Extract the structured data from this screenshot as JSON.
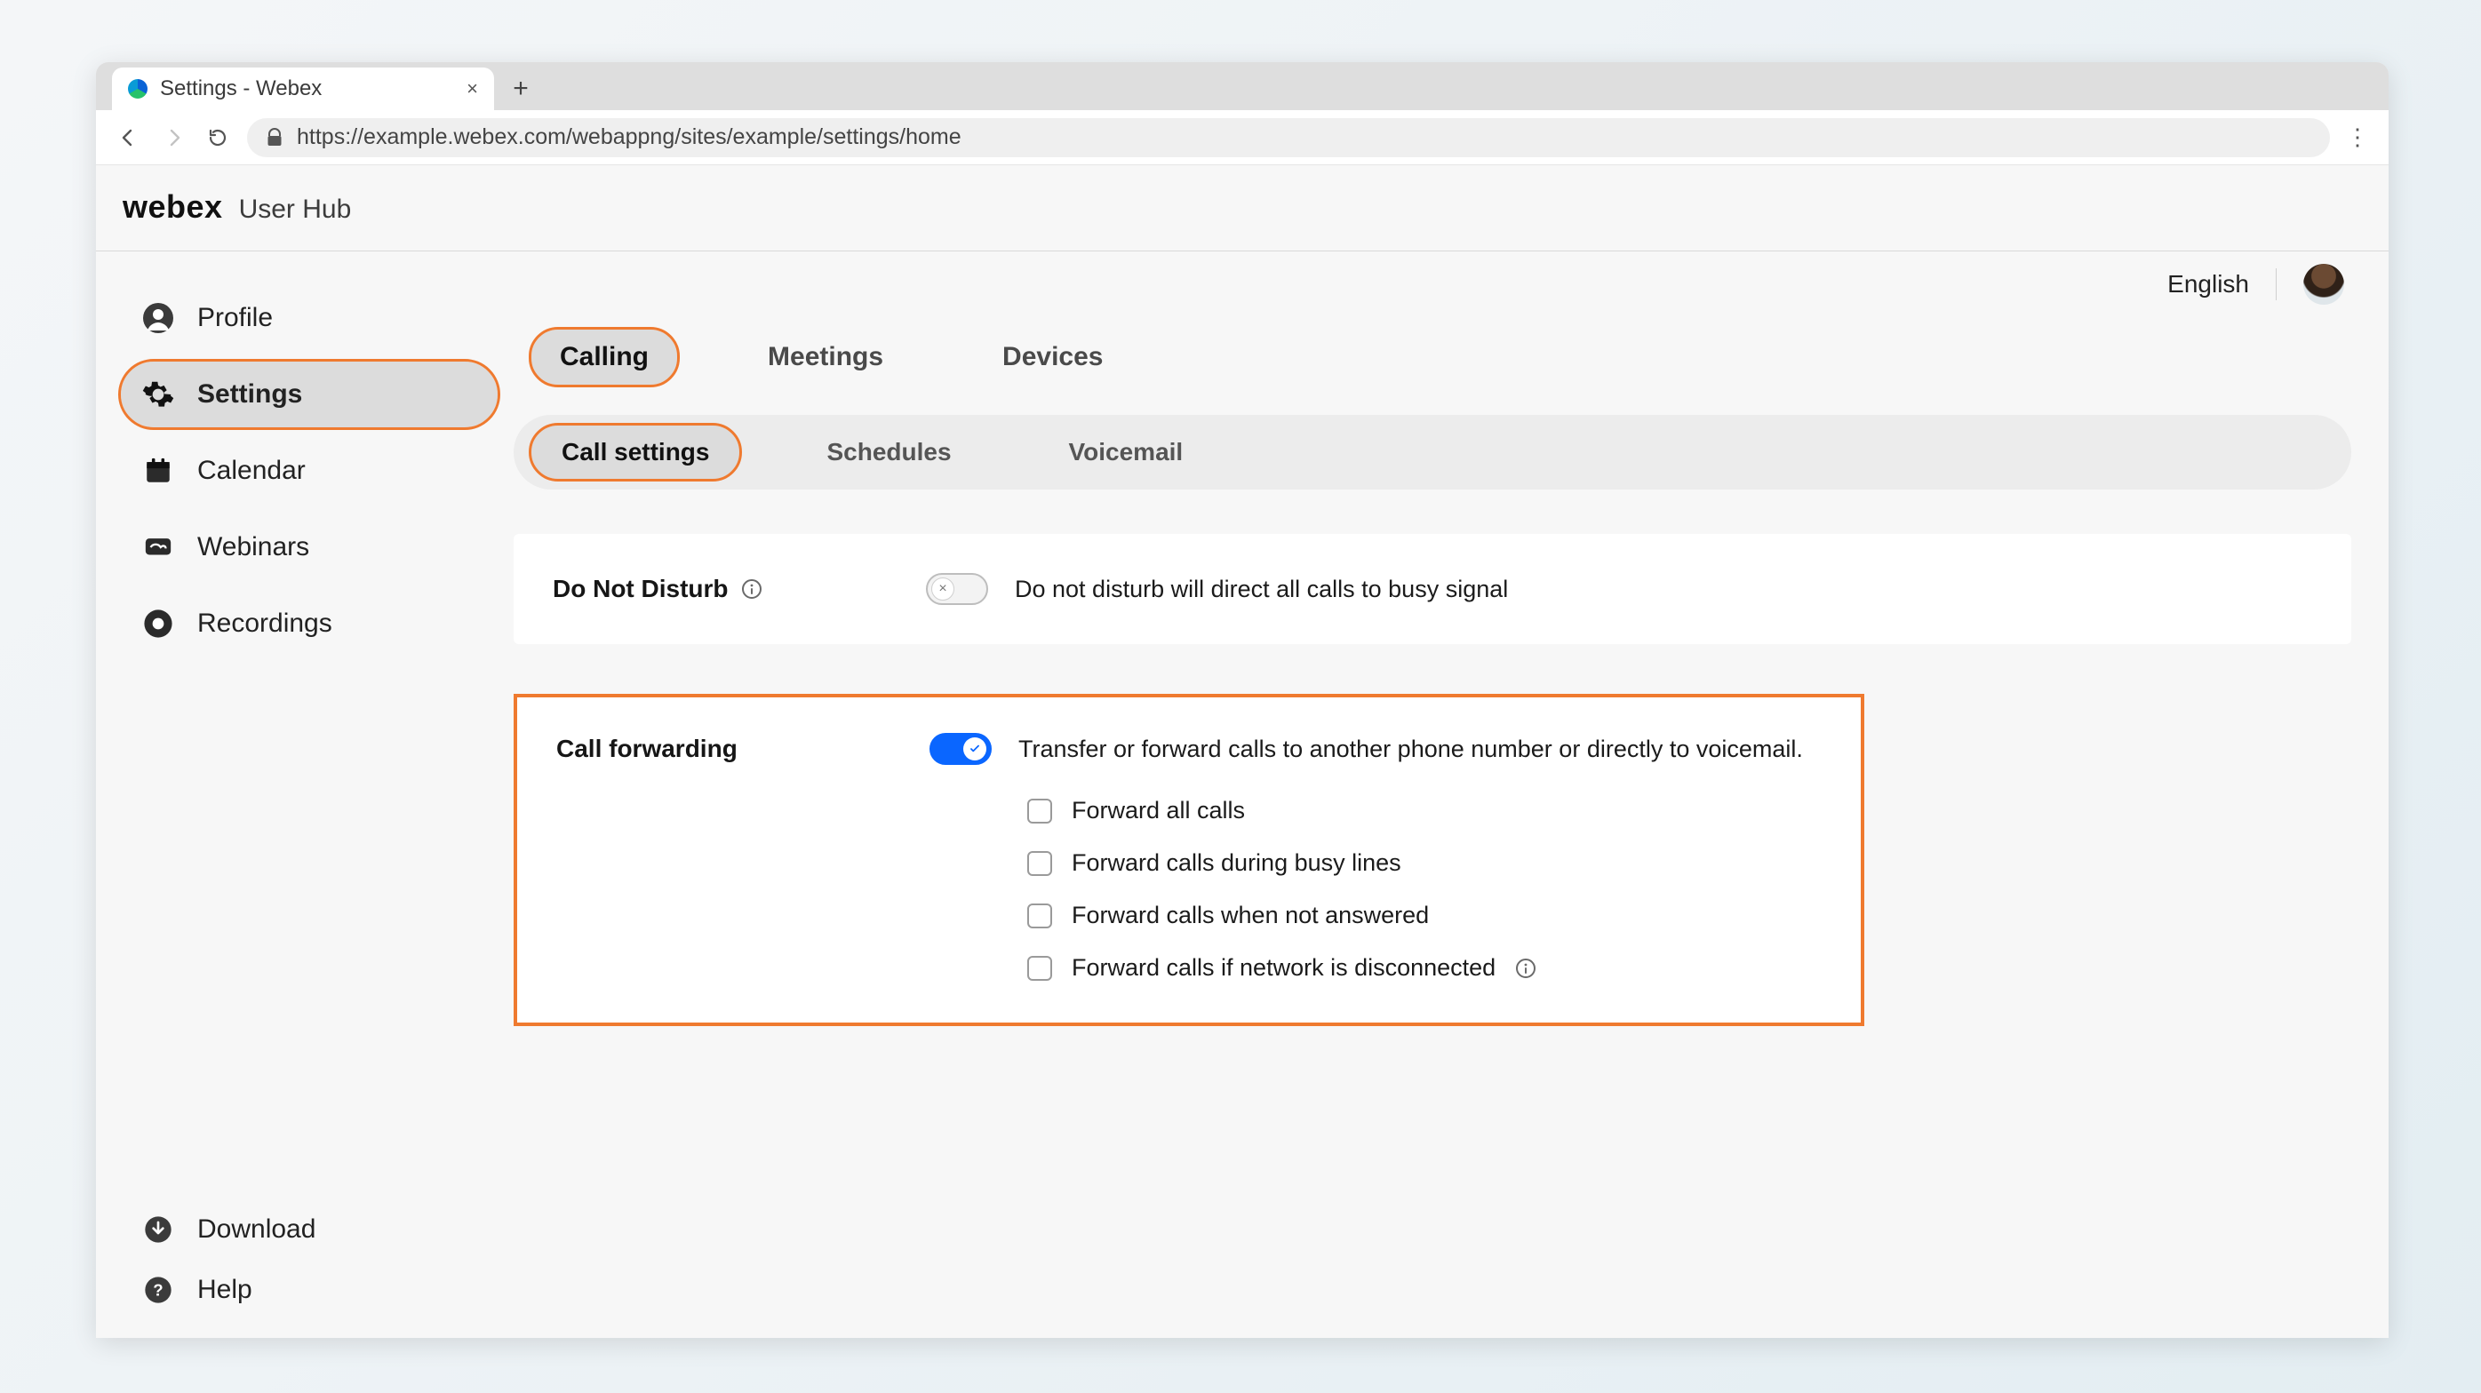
{
  "browser": {
    "tab_title": "Settings - Webex",
    "url": "https://example.webex.com/webappng/sites/example/settings/home"
  },
  "brand": {
    "name": "webex",
    "sub": "User Hub"
  },
  "topbar": {
    "language": "English"
  },
  "sidebar": {
    "items": [
      {
        "id": "profile",
        "label": "Profile"
      },
      {
        "id": "settings",
        "label": "Settings",
        "active": true
      },
      {
        "id": "calendar",
        "label": "Calendar"
      },
      {
        "id": "webinars",
        "label": "Webinars"
      },
      {
        "id": "recordings",
        "label": "Recordings"
      }
    ],
    "bottom": [
      {
        "id": "download",
        "label": "Download"
      },
      {
        "id": "help",
        "label": "Help"
      }
    ]
  },
  "tabs": {
    "primary": [
      {
        "id": "calling",
        "label": "Calling",
        "active": true
      },
      {
        "id": "meetings",
        "label": "Meetings"
      },
      {
        "id": "devices",
        "label": "Devices"
      }
    ],
    "secondary": [
      {
        "id": "call-settings",
        "label": "Call settings",
        "active": true
      },
      {
        "id": "schedules",
        "label": "Schedules"
      },
      {
        "id": "voicemail",
        "label": "Voicemail"
      }
    ]
  },
  "dnd": {
    "title": "Do Not Disturb",
    "enabled": false,
    "description": "Do not disturb will direct all calls to busy signal"
  },
  "call_forwarding": {
    "title": "Call forwarding",
    "enabled": true,
    "description": "Transfer or forward calls to another phone number or directly to voicemail.",
    "options": [
      {
        "id": "fwd-all",
        "label": "Forward all calls",
        "checked": false
      },
      {
        "id": "fwd-busy",
        "label": "Forward calls during busy lines",
        "checked": false
      },
      {
        "id": "fwd-noanswer",
        "label": "Forward calls when not answered",
        "checked": false
      },
      {
        "id": "fwd-disconnected",
        "label": "Forward calls if network is disconnected",
        "checked": false,
        "info": true
      }
    ]
  }
}
